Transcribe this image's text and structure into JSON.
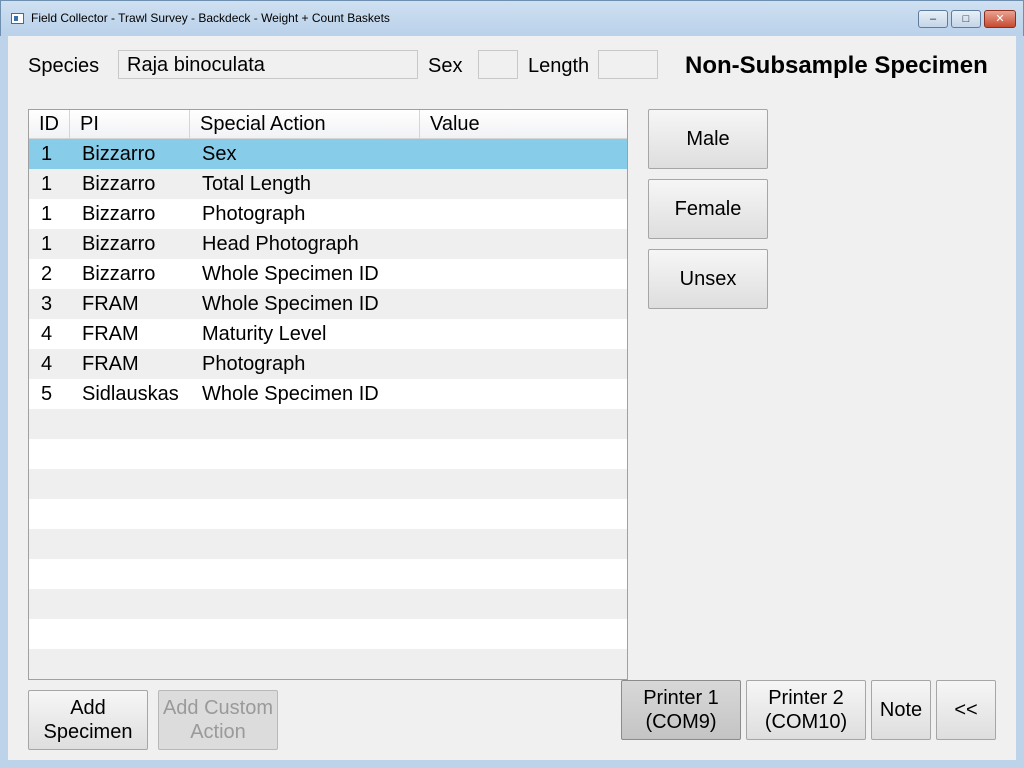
{
  "window": {
    "title": "Field Collector - Trawl Survey - Backdeck - Weight + Count Baskets",
    "minimize": "–",
    "maximize": "□",
    "close": "✕"
  },
  "header": {
    "species_label": "Species",
    "species_value": "Raja binoculata",
    "sex_label": "Sex",
    "sex_value": "",
    "length_label": "Length",
    "length_value": "",
    "heading": "Non-Subsample Specimen"
  },
  "table": {
    "columns": [
      "ID",
      "PI",
      "Special Action",
      "Value"
    ],
    "rows": [
      {
        "id": "1",
        "pi": "Bizzarro",
        "action": "Sex",
        "value": ""
      },
      {
        "id": "1",
        "pi": "Bizzarro",
        "action": "Total Length",
        "value": ""
      },
      {
        "id": "1",
        "pi": "Bizzarro",
        "action": "Photograph",
        "value": ""
      },
      {
        "id": "1",
        "pi": "Bizzarro",
        "action": "Head Photograph",
        "value": ""
      },
      {
        "id": "2",
        "pi": "Bizzarro",
        "action": "Whole Specimen ID",
        "value": ""
      },
      {
        "id": "3",
        "pi": "FRAM",
        "action": "Whole Specimen ID",
        "value": ""
      },
      {
        "id": "4",
        "pi": "FRAM",
        "action": "Maturity Level",
        "value": ""
      },
      {
        "id": "4",
        "pi": "FRAM",
        "action": "Photograph",
        "value": ""
      },
      {
        "id": "5",
        "pi": "Sidlauskas",
        "action": "Whole Specimen ID",
        "value": ""
      }
    ],
    "selected_row": 0
  },
  "sex_buttons": {
    "male": "Male",
    "female": "Female",
    "unsex": "Unsex"
  },
  "bottom": {
    "add_specimen_1": "Add",
    "add_specimen_2": "Specimen",
    "add_custom_1": "Add Custom",
    "add_custom_2": "Action",
    "printer1_1": "Printer 1",
    "printer1_2": "(COM9)",
    "printer2_1": "Printer 2",
    "printer2_2": "(COM10)",
    "note": "Note",
    "back": "<<"
  }
}
